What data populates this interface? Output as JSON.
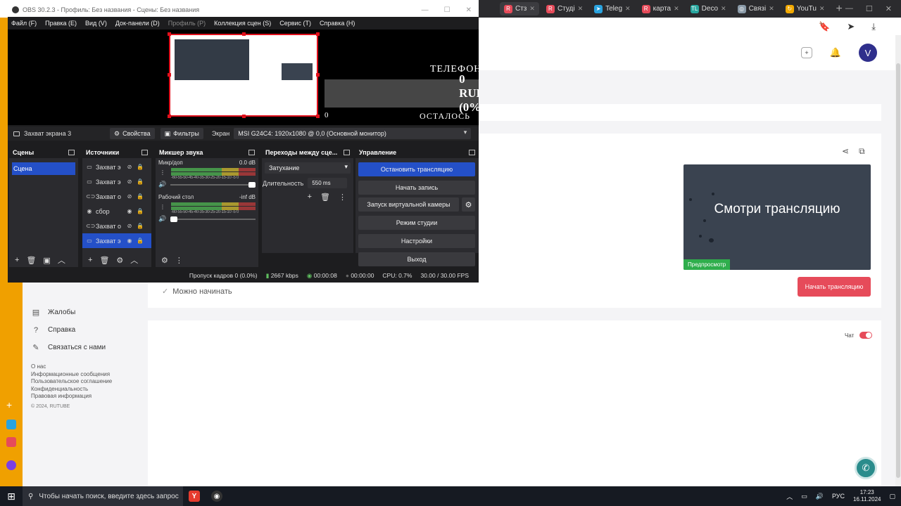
{
  "browser": {
    "tabs": [
      {
        "label": "Стз",
        "fav_color": "#e64b5a",
        "fav_glyph": "R"
      },
      {
        "label": "Студі",
        "fav_color": "#e64b5a",
        "fav_glyph": "R"
      },
      {
        "label": "Teleg",
        "fav_color": "#2aa3df",
        "fav_glyph": "➤"
      },
      {
        "label": "карта",
        "fav_color": "#e64b5a",
        "fav_glyph": "R"
      },
      {
        "label": "Deco",
        "fav_color": "#29a7a0",
        "fav_glyph": "TL"
      },
      {
        "label": "Связі",
        "fav_color": "#8a9aa8",
        "fav_glyph": "◎"
      },
      {
        "label": "YouTu",
        "fav_color": "#f2a900",
        "fav_glyph": "↻"
      }
    ],
    "new_tab": "+"
  },
  "obs": {
    "title": "OBS 30.2.3 - Профиль: Без названия - Сцены: Без названия",
    "menu": [
      {
        "label": "Файл (F)",
        "dim": false
      },
      {
        "label": "Правка (E)",
        "dim": false
      },
      {
        "label": "Вид (V)",
        "dim": false
      },
      {
        "label": "Док-панели (D)",
        "dim": false
      },
      {
        "label": "Профиль (P)",
        "dim": true
      },
      {
        "label": "Коллекция сцен (S)",
        "dim": false
      },
      {
        "label": "Сервис (T)",
        "dim": false
      },
      {
        "label": "Справка (H)",
        "dim": false
      }
    ],
    "overlay": {
      "phone_label": "ТЕЛЕФОН",
      "amount": "0 RUB (0%)",
      "zero": "0",
      "remaining": "ОСТАЛОСЬ"
    },
    "source_bar": {
      "current_source": "Захват экрана 3",
      "properties": "Свойства",
      "filters": "Фильтры",
      "screen_label": "Экран",
      "screen_value": "MSI G24C4: 1920x1080 @ 0,0 (Основной монитор)"
    },
    "docks": {
      "scenes_title": "Сцены",
      "sources_title": "Источники",
      "mixer_title": "Микшер звука",
      "transitions_title": "Переходы между сце...",
      "controls_title": "Управление"
    },
    "scenes": [
      "Сцена"
    ],
    "sources": [
      {
        "name": "Захват э",
        "icon": "▭",
        "eye": "⊘",
        "selected": false
      },
      {
        "name": "Захват э",
        "icon": "▭",
        "eye": "⊘",
        "selected": false
      },
      {
        "name": "Захват о",
        "icon": "⊂⊃",
        "eye": "⊘",
        "selected": false
      },
      {
        "name": "сбор",
        "icon": "◉",
        "eye": "◉",
        "selected": false
      },
      {
        "name": "Захват о",
        "icon": "⊂⊃",
        "eye": "⊘",
        "selected": false
      },
      {
        "name": "Захват э",
        "icon": "▭",
        "eye": "◉",
        "selected": true
      }
    ],
    "mixer": [
      {
        "name": "Микр/доп",
        "db": "0.0 dB",
        "ticks": "-60-55-50-45-40-35-30-25-20-15-10 -5 0",
        "fader_level": 1.0
      },
      {
        "name": "Рабочий стол",
        "db": "-inf dB",
        "ticks": "-60-55-50-45-40-35-30-25-20-15-10 -5 0",
        "fader_level": 0.0
      }
    ],
    "transitions": {
      "selected": "Затухание",
      "duration_label": "Длительность",
      "duration_value": "550 ms"
    },
    "controls": {
      "stop_stream": "Остановить трансляцию",
      "start_recording": "Начать запись",
      "virtual_cam": "Запуск виртуальной камеры",
      "studio_mode": "Режим студии",
      "settings": "Настройки",
      "exit": "Выход"
    },
    "status": {
      "dropped": "Пропуск кадров 0 (0.0%)",
      "bitrate": "2667 kbps",
      "stream_time": "00:00:08",
      "rec_time": "00:00:00",
      "cpu": "CPU: 0.7%",
      "fps": "30.00 / 30.00 FPS"
    }
  },
  "rutube": {
    "preview_title": "Смотри трансляцию",
    "preview_badge": "Предпросмотр",
    "start_button": "Начать трансляцию",
    "ready_status": "Можно начинать",
    "chat_label": "Чат",
    "nav": [
      {
        "label": "Жалобы",
        "icon": "▤"
      },
      {
        "label": "Справка",
        "icon": "?"
      },
      {
        "label": "Связаться с нами",
        "icon": "✎"
      }
    ],
    "links": [
      "О нас",
      "Информационные сообщения",
      "Пользовательское соглашение",
      "Конфиденциальность",
      "Правовая информация"
    ],
    "copyright": "© 2024, RUTUBE"
  },
  "taskbar": {
    "search_placeholder": "Чтобы начать поиск, введите здесь запрос",
    "lang": "РУС",
    "time": "17:23",
    "date": "16.11.2024"
  }
}
